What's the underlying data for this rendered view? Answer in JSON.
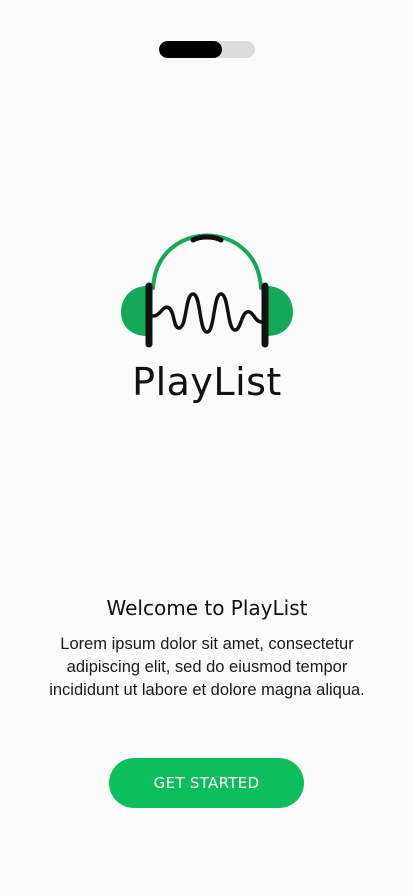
{
  "onboarding": {
    "progress": 0.66,
    "app_name": "PlayList",
    "welcome_title": "Welcome to PlayList",
    "welcome_body": "Lorem ipsum dolor sit amet, consectetur adipiscing elit, sed do eiusmod tempor incididunt ut labore et dolore magna aliqua.",
    "cta_label": "GET STARTED"
  },
  "colors": {
    "brand_green": "#0cbf5c",
    "logo_green": "#14a85a",
    "text_dark": "#111111",
    "progress_track": "#dcdcdc",
    "progress_fill": "#000000"
  },
  "icons": {
    "logo": "headphones-waveform-icon"
  }
}
